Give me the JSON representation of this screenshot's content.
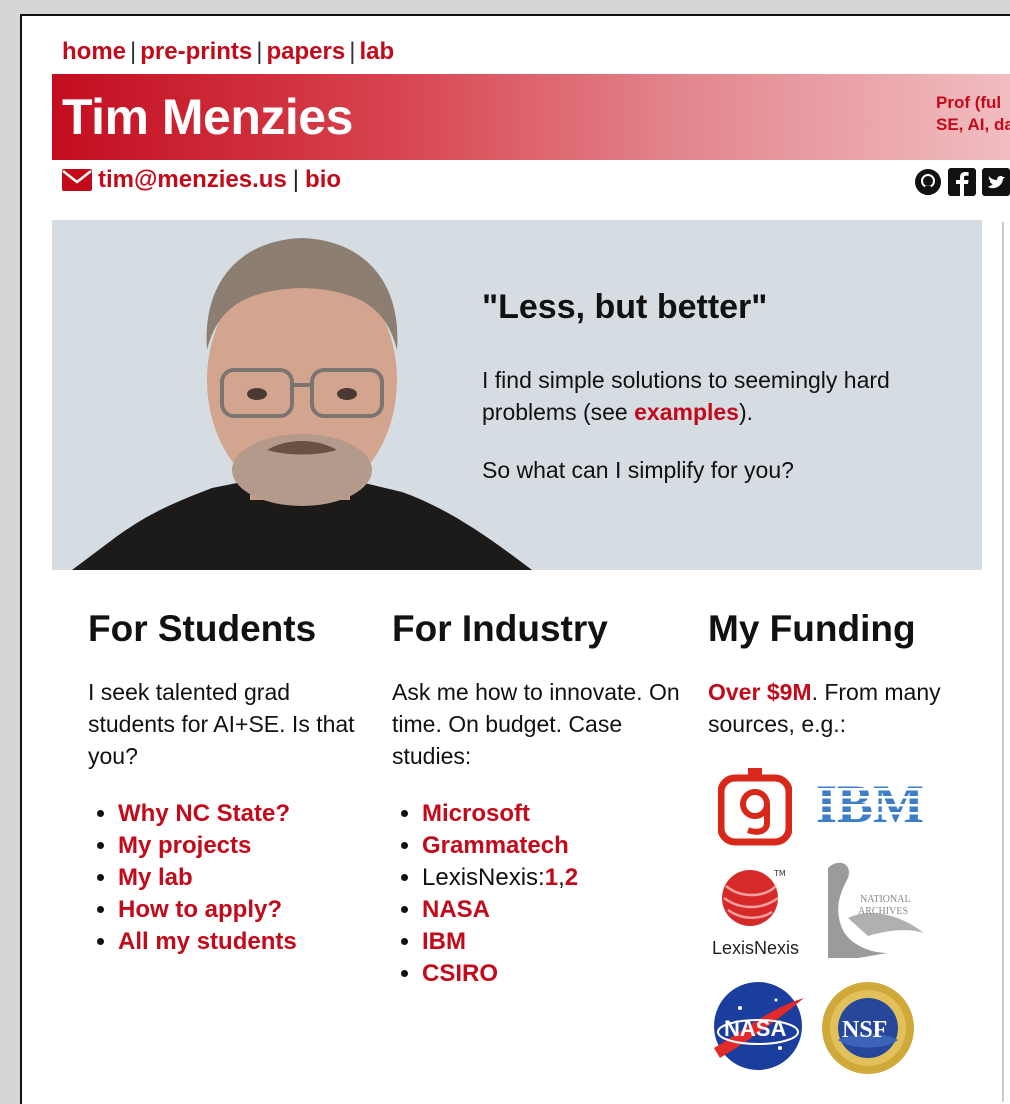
{
  "nav": {
    "home": "home",
    "preprints": "pre-prints",
    "papers": "papers",
    "lab": "lab",
    "sep": "|"
  },
  "banner": {
    "name": "Tim Menzies",
    "tag1": "Prof (ful",
    "tag2": "SE, AI, da"
  },
  "contact": {
    "email": "tim@menzies.us",
    "bio": "bio",
    "sep": "|"
  },
  "social": [
    "github-icon",
    "facebook-icon",
    "twitter-icon"
  ],
  "hero": {
    "quote": "\"Less, but better\"",
    "p1_pre": "I find simple solutions to seemingly hard problems (see ",
    "p1_link": "examples",
    "p1_post": ").",
    "p2": "So what can I simplify for you?"
  },
  "students": {
    "title": "For Students",
    "text": "I seek talented grad students for AI+SE. Is that you?",
    "links": [
      "Why NC State?",
      "My projects",
      "My lab",
      "How to apply?",
      "All my students"
    ]
  },
  "industry": {
    "title": "For Industry",
    "text": "Ask me how to innovate. On time. On budget. Case studies:",
    "items": {
      "microsoft": "Microsoft",
      "grammatech": "Grammatech",
      "lexis_label": "LexisNexis:",
      "lexis_1": "1",
      "lexis_comma": ",",
      "lexis_2": "2",
      "nasa": "NASA",
      "ibm": "IBM",
      "csiro": "CSIRO"
    }
  },
  "funding": {
    "title": "My Funding",
    "highlight": "Over $9M",
    "text": ". From many sources, e.g.:",
    "logos": {
      "ibm": "IBM",
      "lexisnexis": "LexisNexis",
      "archives1": "NATIONAL",
      "archives2": "ARCHIVES",
      "nasa": "NASA",
      "nsf": "NSF"
    }
  },
  "colors": {
    "accent": "#c20a1a",
    "hero_bg": "#d5dde3"
  }
}
